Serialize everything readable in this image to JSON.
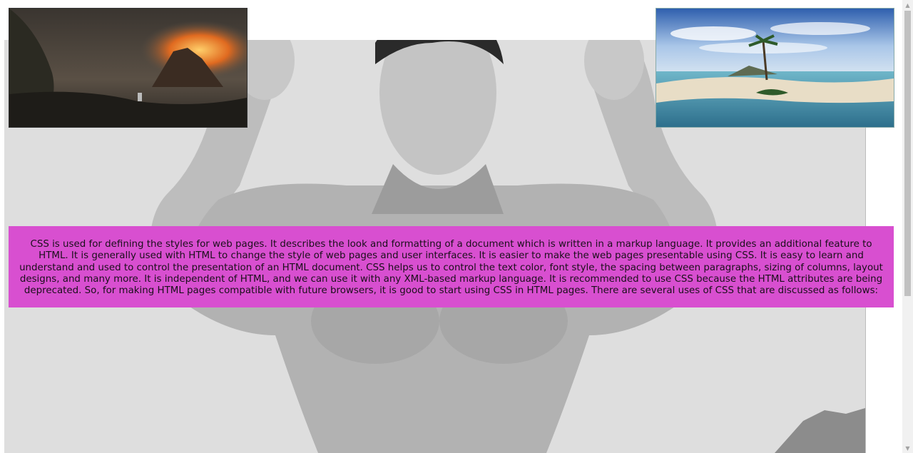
{
  "main": {
    "paragraph": "CSS is used for defining the styles for web pages. It describes the look and formatting of a document which is written in a markup language. It provides an additional feature to HTML. It is generally used with HTML to change the style of web pages and user interfaces. It is easier to make the web pages presentable using CSS. It is easy to learn and understand and used to control the presentation of an HTML document. CSS helps us to control the text color, font style, the spacing between paragraphs, sizing of columns, layout designs, and many more. It is independent of HTML, and we can use it with any XML-based markup language. It is recommended to use CSS because the HTML attributes are being deprecated. So, for making HTML pages compatible with future browsers, it is good to start using CSS in HTML pages. There are several uses of CSS that are discussed as follows:",
    "panel_color": "#d84fd0"
  },
  "images": {
    "background": "grayscale-bodybuilder-photo",
    "left_thumb": "fantasy-burning-temple-painting",
    "right_thumb": "tropical-island-beach"
  },
  "scrollbar": {
    "up_icon": "scroll-up-arrow-icon",
    "down_icon": "scroll-down-arrow-icon"
  }
}
